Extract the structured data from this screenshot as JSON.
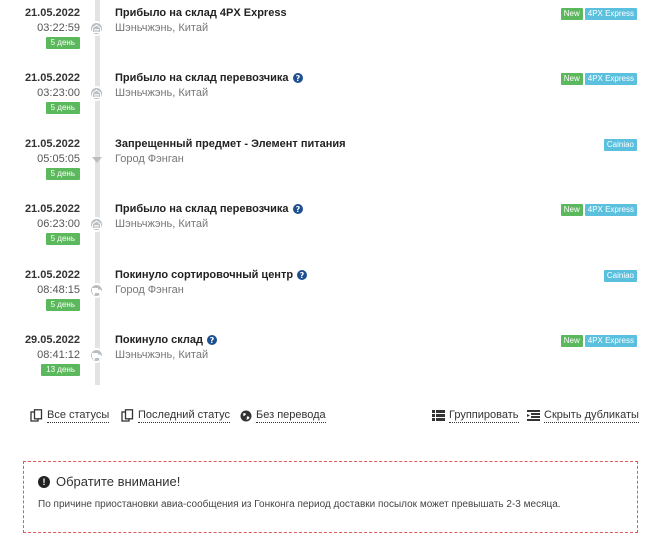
{
  "events": [
    {
      "date": "21.05.2022",
      "time": "03:22:59",
      "days": "5 день",
      "status": "Прибыло на склад 4PX Express",
      "help": false,
      "location": "Шэньчжэнь, Китай",
      "icon": "warehouse-icon",
      "tags": [
        {
          "label": "New",
          "color": "#5cb85c"
        },
        {
          "label": "4PX Express",
          "color": "#5bc0de"
        }
      ]
    },
    {
      "date": "21.05.2022",
      "time": "03:23:00",
      "days": "5 день",
      "status": "Прибыло на склад перевозчика",
      "help": true,
      "location": "Шэньчжэнь, Китай",
      "icon": "warehouse-icon",
      "tags": [
        {
          "label": "New",
          "color": "#5cb85c"
        },
        {
          "label": "4PX Express",
          "color": "#5bc0de"
        }
      ]
    },
    {
      "date": "21.05.2022",
      "time": "05:05:05",
      "days": "5 день",
      "status": "Запрещенный предмет - Элемент питания",
      "help": false,
      "location": "Город Фэнган",
      "icon": "arrow-down-icon",
      "tags": [
        {
          "label": "Cainiao",
          "color": "#5bc0de"
        }
      ]
    },
    {
      "date": "21.05.2022",
      "time": "06:23:00",
      "days": "5 день",
      "status": "Прибыло на склад перевозчика",
      "help": true,
      "location": "Шэньчжэнь, Китай",
      "icon": "warehouse-icon",
      "tags": [
        {
          "label": "New",
          "color": "#5cb85c"
        },
        {
          "label": "4PX Express",
          "color": "#5bc0de"
        }
      ]
    },
    {
      "date": "21.05.2022",
      "time": "08:48:15",
      "days": "5 день",
      "status": "Покинуло сортировочный центр",
      "help": true,
      "location": "Город Фэнган",
      "icon": "truck-icon",
      "tags": [
        {
          "label": "Cainiao",
          "color": "#5bc0de"
        }
      ]
    },
    {
      "date": "29.05.2022",
      "time": "08:41:12",
      "days": "13 день",
      "status": "Покинуло склад",
      "help": true,
      "location": "Шэньчжэнь, Китай",
      "icon": "truck-icon",
      "tags": [
        {
          "label": "New",
          "color": "#5cb85c"
        },
        {
          "label": "4PX Express",
          "color": "#5bc0de"
        }
      ]
    }
  ],
  "actions": {
    "all_statuses": {
      "label": "Все статусы",
      "icon": "copy-icon"
    },
    "last_status": {
      "label": "Последний статус",
      "icon": "copy-icon"
    },
    "no_translation": {
      "label": "Без перевода",
      "icon": "globe-icon"
    },
    "group": {
      "label": "Группировать",
      "icon": "list-icon"
    },
    "hide_duplicates": {
      "label": "Скрыть дубликаты",
      "icon": "list-remove-icon"
    }
  },
  "notice": {
    "title": "Обратите внимание!",
    "text": "По причине приостановки авиа-сообщения из Гонконга период доставки посылок может превышать 2-3 месяца.",
    "border_color": "#e05a5a"
  }
}
